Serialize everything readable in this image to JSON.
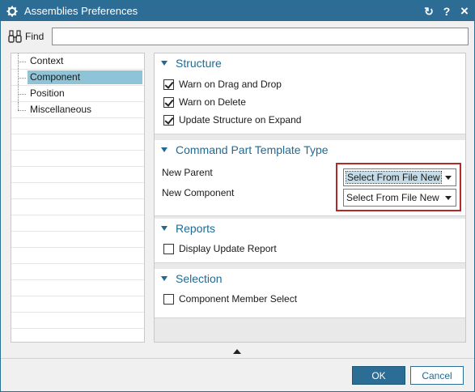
{
  "window": {
    "title": "Assemblies Preferences",
    "controls": {
      "reset": "↻",
      "help": "?",
      "close": "×"
    }
  },
  "find": {
    "label": "Find",
    "value": "",
    "placeholder": ""
  },
  "tree": {
    "items": [
      {
        "label": "Context",
        "selected": false
      },
      {
        "label": "Component",
        "selected": true
      },
      {
        "label": "Position",
        "selected": false
      },
      {
        "label": "Miscellaneous",
        "selected": false
      }
    ]
  },
  "sections": {
    "structure": {
      "title": "Structure",
      "options": [
        {
          "label": "Warn on Drag and Drop",
          "checked": true
        },
        {
          "label": "Warn on Delete",
          "checked": true
        },
        {
          "label": "Update Structure on Expand",
          "checked": true
        }
      ]
    },
    "template": {
      "title": "Command Part Template Type",
      "new_parent_label": "New Parent",
      "new_parent_value": "Select From File New",
      "new_component_label": "New Component",
      "new_component_value": "Select From File New"
    },
    "reports": {
      "title": "Reports",
      "options": [
        {
          "label": "Display Update Report",
          "checked": false
        }
      ]
    },
    "selection": {
      "title": "Selection",
      "options": [
        {
          "label": "Component Member Select",
          "checked": false
        }
      ]
    }
  },
  "buttons": {
    "ok": "OK",
    "cancel": "Cancel"
  },
  "colors": {
    "titlebar": "#2d6d95",
    "accent": "#1f6a93",
    "selection": "#8fc3d7",
    "highlight": "#b02a2a"
  }
}
